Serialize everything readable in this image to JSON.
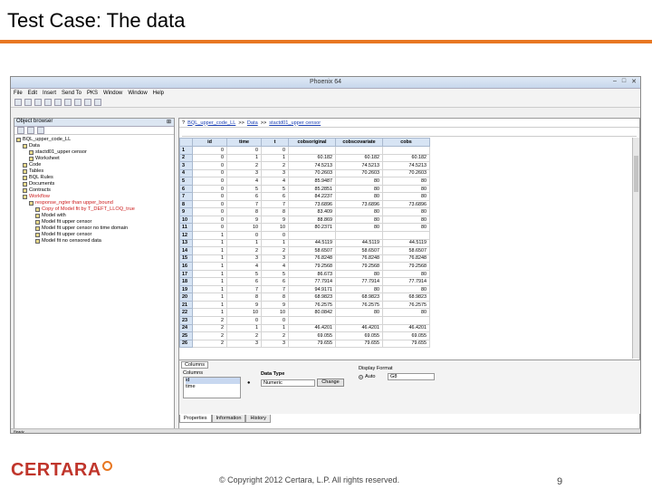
{
  "slide": {
    "title": "Test Case: The data",
    "copyright": "© Copyright 2012 Certara, L.P.  All rights reserved.",
    "page_number": "9",
    "logo_text": "CERTARA",
    "accent_color": "#e87722",
    "logo_color": "#c0352b"
  },
  "app": {
    "window_title": "Phoenix 64",
    "window_buttons": [
      "–",
      "□",
      "✕"
    ],
    "menu": [
      "File",
      "Edit",
      "Insert",
      "Send To",
      "PKS",
      "Window",
      "Window",
      "Help"
    ],
    "object_browser": {
      "title": "Object browser",
      "pin": "⊞"
    },
    "tree": [
      {
        "label": "BQL_upper_code_LL",
        "indent": 0,
        "red": false
      },
      {
        "label": "Data",
        "indent": 1,
        "red": false
      },
      {
        "label": "stactd01_upper censor",
        "indent": 2,
        "red": false
      },
      {
        "label": "Worksheet",
        "indent": 2,
        "red": false
      },
      {
        "label": "Code",
        "indent": 1,
        "red": false
      },
      {
        "label": "Tables",
        "indent": 1,
        "red": false
      },
      {
        "label": "BQL Rules",
        "indent": 1,
        "red": false
      },
      {
        "label": "Documents",
        "indent": 1,
        "red": false
      },
      {
        "label": "Contracts",
        "indent": 1,
        "red": false
      },
      {
        "label": "Workflow",
        "indent": 1,
        "red": true
      },
      {
        "label": "response_ngter than upper_bound",
        "indent": 2,
        "red": true
      },
      {
        "label": "Copy of Model fit by T_DEFT_LLOQ_true",
        "indent": 3,
        "red": true
      },
      {
        "label": "Model with",
        "indent": 3,
        "red": false
      },
      {
        "label": "Model fit upper censor",
        "indent": 3,
        "red": false
      },
      {
        "label": "Model fit upper censor no time domain",
        "indent": 3,
        "red": false
      },
      {
        "label": "Model fit upper censor",
        "indent": 3,
        "red": false
      },
      {
        "label": "Model fit no censored data",
        "indent": 3,
        "red": false
      }
    ],
    "breadcrumb": {
      "prefix": "?",
      "items": [
        "BQL_upper_code_LL",
        "Data",
        "stactd01_upper censor"
      ],
      "separator": ">>"
    },
    "grid": {
      "columns": [
        "",
        "id",
        "time",
        "t",
        "cobsoriginal",
        "cobscovariate",
        "cobs"
      ],
      "rows": [
        [
          "1",
          "0",
          "0",
          "0",
          "",
          "",
          ""
        ],
        [
          "2",
          "0",
          "1",
          "1",
          "60.182",
          "60.182",
          "60.182"
        ],
        [
          "3",
          "0",
          "2",
          "2",
          "74.5213",
          "74.5213",
          "74.5213"
        ],
        [
          "4",
          "0",
          "3",
          "3",
          "70.2603",
          "70.2603",
          "70.2603"
        ],
        [
          "5",
          "0",
          "4",
          "4",
          "85.9487",
          "80",
          "80"
        ],
        [
          "6",
          "0",
          "5",
          "5",
          "85.2851",
          "80",
          "80"
        ],
        [
          "7",
          "0",
          "6",
          "6",
          "84.2237",
          "80",
          "80"
        ],
        [
          "8",
          "0",
          "7",
          "7",
          "73.6896",
          "73.6896",
          "73.6896"
        ],
        [
          "9",
          "0",
          "8",
          "8",
          "83.409",
          "80",
          "80"
        ],
        [
          "10",
          "0",
          "9",
          "9",
          "88.869",
          "80",
          "80"
        ],
        [
          "11",
          "0",
          "10",
          "10",
          "80.2371",
          "80",
          "80"
        ],
        [
          "12",
          "1",
          "0",
          "0",
          "",
          "",
          ""
        ],
        [
          "13",
          "1",
          "1",
          "1",
          "44.5119",
          "44.5119",
          "44.5119"
        ],
        [
          "14",
          "1",
          "2",
          "2",
          "58.6507",
          "58.6507",
          "58.6507"
        ],
        [
          "15",
          "1",
          "3",
          "3",
          "76.8248",
          "76.8248",
          "76.8248"
        ],
        [
          "16",
          "1",
          "4",
          "4",
          "79.2568",
          "79.2568",
          "79.2568"
        ],
        [
          "17",
          "1",
          "5",
          "5",
          "86.673",
          "80",
          "80"
        ],
        [
          "18",
          "1",
          "6",
          "6",
          "77.7914",
          "77.7914",
          "77.7914"
        ],
        [
          "19",
          "1",
          "7",
          "7",
          "94.9171",
          "80",
          "80"
        ],
        [
          "20",
          "1",
          "8",
          "8",
          "68.9823",
          "68.9823",
          "68.9823"
        ],
        [
          "21",
          "1",
          "9",
          "9",
          "76.2575",
          "76.2575",
          "76.2575"
        ],
        [
          "22",
          "1",
          "10",
          "10",
          "80.0842",
          "80",
          "80"
        ],
        [
          "23",
          "2",
          "0",
          "0",
          "",
          "",
          ""
        ],
        [
          "24",
          "2",
          "1",
          "1",
          "46.4201",
          "46.4201",
          "46.4201"
        ],
        [
          "25",
          "2",
          "2",
          "2",
          "69.055",
          "69.055",
          "69.055"
        ],
        [
          "26",
          "2",
          "3",
          "3",
          "79.655",
          "79.655",
          "79.655"
        ]
      ]
    },
    "columns_panel": {
      "tab": "Columns",
      "list_label": "Columns",
      "list_items": [
        "id",
        "time"
      ],
      "data_type_label": "Data Type",
      "data_type_value": "Numeric",
      "change_button": "Change",
      "display_format_label": "Display Format",
      "format_mode": "Auto",
      "format_value": "G8"
    },
    "bottom_tabs": [
      "Properties",
      "Information",
      "History"
    ],
    "status": "Ready"
  }
}
